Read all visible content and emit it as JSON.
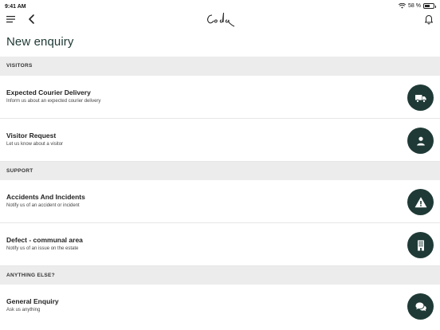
{
  "status_bar": {
    "time": "9:41 AM",
    "battery_text": "58 %",
    "battery_level": 0.58
  },
  "header": {
    "logo_text": "Coda"
  },
  "page": {
    "title": "New enquiry"
  },
  "sections": [
    {
      "label": "VISITORS"
    },
    {
      "label": "SUPPORT"
    },
    {
      "label": "ANYTHING ELSE?"
    }
  ],
  "items": [
    {
      "title": "Expected Courier Delivery",
      "subtitle": "Inform us about an expected courier delivery",
      "icon": "truck-icon"
    },
    {
      "title": "Visitor Request",
      "subtitle": "Let us know about a visitor",
      "icon": "person-icon"
    },
    {
      "title": "Accidents And Incidents",
      "subtitle": "Notify us of an accident or incident",
      "icon": "warning-icon"
    },
    {
      "title": "Defect - communal area",
      "subtitle": "Notify us of an issue on the estate",
      "icon": "building-icon"
    },
    {
      "title": "General Enquiry",
      "subtitle": "Ask us anything",
      "icon": "chat-icon"
    }
  ],
  "colors": {
    "accent": "#1f3a36",
    "section_bg": "#ececec"
  }
}
